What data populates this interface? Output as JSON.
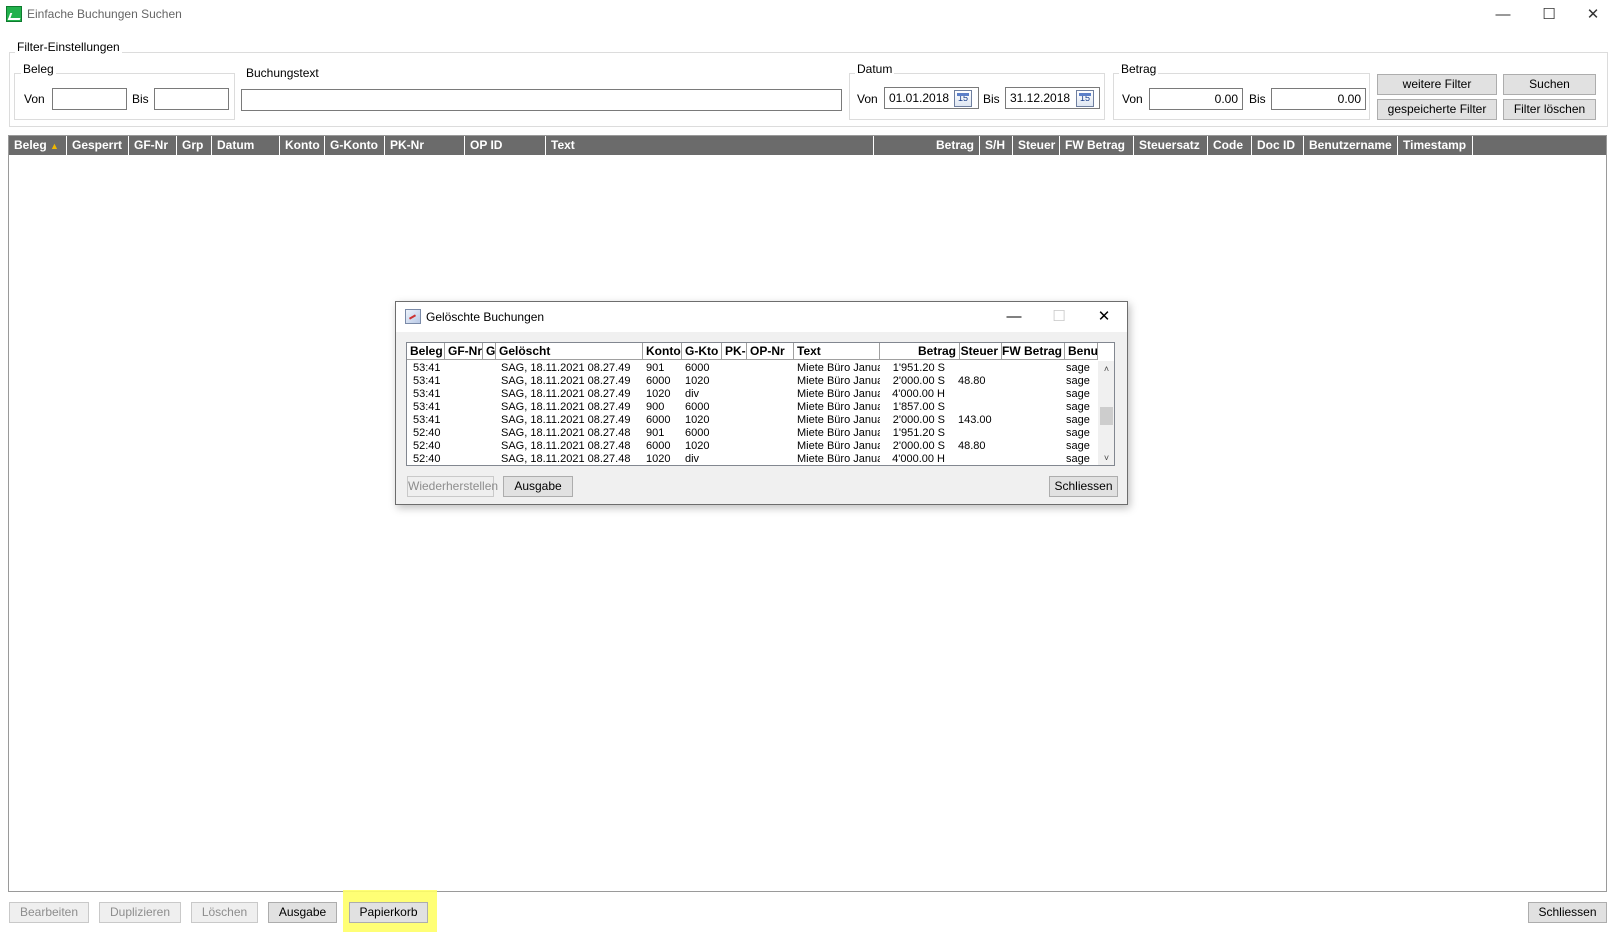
{
  "window": {
    "title": "Einfache Buchungen Suchen",
    "minimize": "—",
    "maximize": "☐",
    "close": "✕"
  },
  "filter": {
    "group_title": "Filter-Einstellungen",
    "beleg": {
      "title": "Beleg",
      "von_label": "Von",
      "bis_label": "Bis",
      "von_value": "",
      "bis_value": ""
    },
    "buchungstext": {
      "title": "Buchungstext",
      "value": ""
    },
    "datum": {
      "title": "Datum",
      "von_label": "Von",
      "bis_label": "Bis",
      "von_value": "01.01.2018",
      "bis_value": "31.12.2018",
      "calendar_label": "15"
    },
    "betrag": {
      "title": "Betrag",
      "von_label": "Von",
      "bis_label": "Bis",
      "von_value": "0.00",
      "bis_value": "0.00"
    },
    "buttons": {
      "weitere": "weitere Filter",
      "suchen": "Suchen",
      "gespeicherte": "gespeicherte Filter",
      "loeschen": "Filter löschen"
    }
  },
  "grid": {
    "columns": [
      "Beleg",
      "Gesperrt",
      "GF-Nr",
      "Grp",
      "Datum",
      "Konto",
      "G-Konto",
      "PK-Nr",
      "OP ID",
      "Text",
      "Betrag",
      "S/H",
      "Steuer",
      "FW Betrag",
      "Steuersatz",
      "Code",
      "Doc ID",
      "Benutzername",
      "Timestamp"
    ],
    "sort_indicator": "▲"
  },
  "dialog": {
    "title": "Gelöschte Buchungen",
    "minimize": "—",
    "maximize": "☐",
    "close": "✕",
    "columns": [
      "Beleg",
      "GF-Nr",
      "G",
      "Gelöscht",
      "Konto",
      "G-Kto",
      "PK-",
      "OP-Nr",
      "Text",
      "Betrag",
      "Steuer",
      "FW Betrag",
      "Benu"
    ],
    "rows": [
      {
        "beleg": "53:41",
        "geloescht": "SAG, 18.11.2021 08.27.49",
        "konto": "901",
        "gkto": "6000",
        "text": "Miete Büro Janua",
        "betrag": "1'951.20 S",
        "steuer": "",
        "benu": "sage"
      },
      {
        "beleg": "53:41",
        "geloescht": "SAG, 18.11.2021 08.27.49",
        "konto": "6000",
        "gkto": "1020",
        "text": "Miete Büro Janua",
        "betrag": "2'000.00 S",
        "steuer": "48.80",
        "benu": "sage"
      },
      {
        "beleg": "53:41",
        "geloescht": "SAG, 18.11.2021 08.27.49",
        "konto": "1020",
        "gkto": "div",
        "text": "Miete Büro Janua",
        "betrag": "4'000.00 H",
        "steuer": "",
        "benu": "sage"
      },
      {
        "beleg": "53:41",
        "geloescht": "SAG, 18.11.2021 08.27.49",
        "konto": "900",
        "gkto": "6000",
        "text": "Miete Büro Janua",
        "betrag": "1'857.00 S",
        "steuer": "",
        "benu": "sage"
      },
      {
        "beleg": "53:41",
        "geloescht": "SAG, 18.11.2021 08.27.49",
        "konto": "6000",
        "gkto": "1020",
        "text": "Miete Büro Janua",
        "betrag": "2'000.00 S",
        "steuer": "143.00",
        "benu": "sage"
      },
      {
        "beleg": "52:40",
        "geloescht": "SAG, 18.11.2021 08.27.48",
        "konto": "901",
        "gkto": "6000",
        "text": "Miete Büro Janua",
        "betrag": "1'951.20 S",
        "steuer": "",
        "benu": "sage"
      },
      {
        "beleg": "52:40",
        "geloescht": "SAG, 18.11.2021 08.27.48",
        "konto": "6000",
        "gkto": "1020",
        "text": "Miete Büro Janua",
        "betrag": "2'000.00 S",
        "steuer": "48.80",
        "benu": "sage"
      },
      {
        "beleg": "52:40",
        "geloescht": "SAG, 18.11.2021 08.27.48",
        "konto": "1020",
        "gkto": "div",
        "text": "Miete Büro Janua",
        "betrag": "4'000.00 H",
        "steuer": "",
        "benu": "sage"
      }
    ],
    "scroll_up": "˄",
    "scroll_down": "˅",
    "buttons": {
      "wiederherstellen": "Wiederherstellen",
      "ausgabe": "Ausgabe",
      "schliessen": "Schliessen"
    }
  },
  "bottom": {
    "bearbeiten": "Bearbeiten",
    "duplizieren": "Duplizieren",
    "loeschen": "Löschen",
    "ausgabe": "Ausgabe",
    "papierkorb": "Papierkorb",
    "schliessen": "Schliessen"
  },
  "colors": {
    "grid_header": "#6b6b6b",
    "highlight": "#ffff66",
    "button": "#e1e1e1"
  }
}
